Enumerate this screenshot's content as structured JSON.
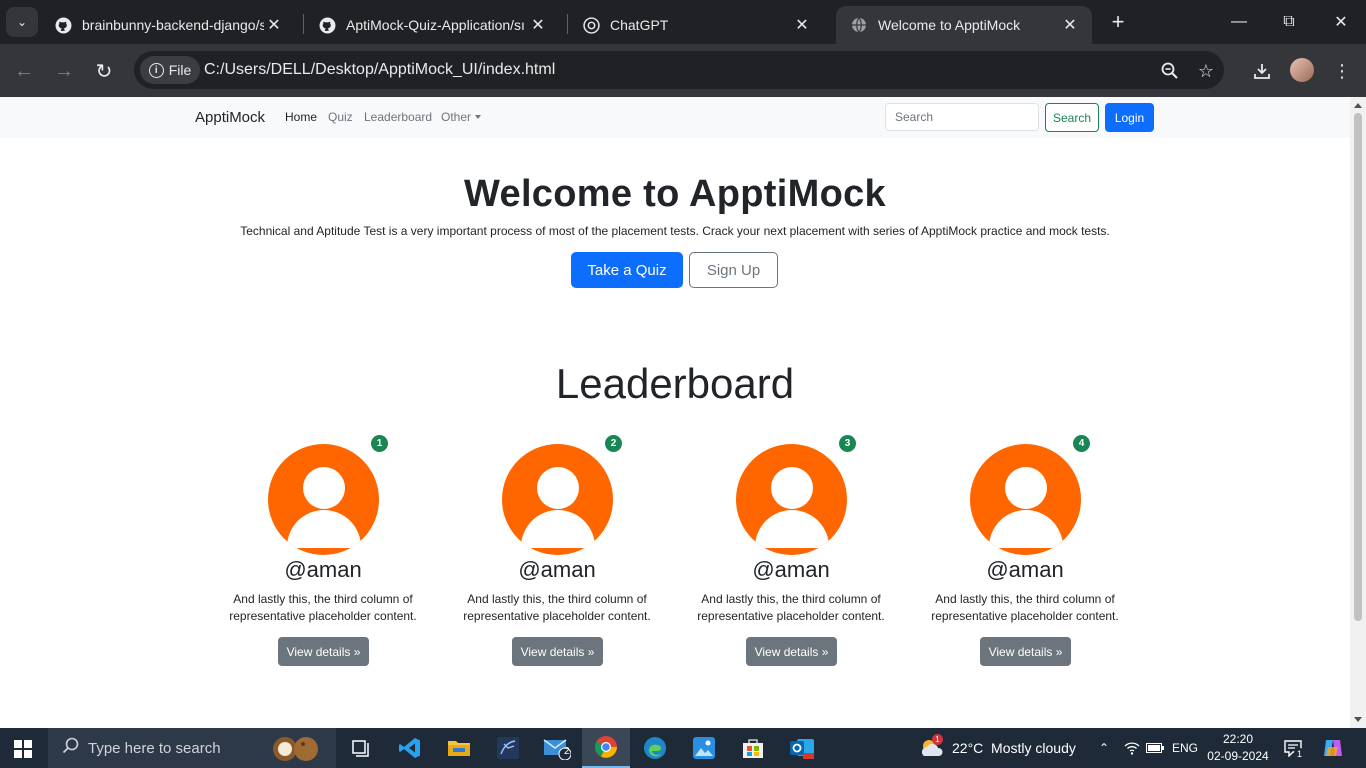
{
  "browser": {
    "tabs": [
      {
        "title": "brainbunny-backend-django/st",
        "icon": "github-icon"
      },
      {
        "title": "AptiMock-Quiz-Application/sı",
        "icon": "github-icon"
      },
      {
        "title": "ChatGPT",
        "icon": "chatgpt-icon"
      },
      {
        "title": "Welcome to ApptiMock",
        "icon": "globe-icon",
        "active": true
      }
    ],
    "address_chip": "File",
    "url": "C:/Users/DELL/Desktop/ApptiMock_UI/index.html"
  },
  "navbar": {
    "brand": "ApptiMock",
    "links": [
      "Home",
      "Quiz",
      "Leaderboard",
      "Other"
    ],
    "search_placeholder": "Search",
    "search_button": "Search",
    "login_button": "Login"
  },
  "hero": {
    "title": "Welcome to ApptiMock",
    "lead": "Technical and Aptitude Test is a very important process of most of the placement tests. Crack your next placement with series of ApptiMock practice and mock tests.",
    "primary_button": "Take a Quiz",
    "secondary_button": "Sign Up"
  },
  "leaderboard": {
    "title": "Leaderboard",
    "entries": [
      {
        "rank": "1",
        "username": "@aman",
        "description": "And lastly this, the third column of representative placeholder content.",
        "button": "View details »"
      },
      {
        "rank": "2",
        "username": "@aman",
        "description": "And lastly this, the third column of representative placeholder content.",
        "button": "View details »"
      },
      {
        "rank": "3",
        "username": "@aman",
        "description": "And lastly this, the third column of representative placeholder content.",
        "button": "View details »"
      },
      {
        "rank": "4",
        "username": "@aman",
        "description": "And lastly this, the third column of representative placeholder content.",
        "button": "View details »"
      }
    ]
  },
  "taskbar": {
    "search_placeholder": "Type here to search",
    "mail_badge": "2",
    "weather_badge": "1",
    "weather": "22°C  Mostly cloudy",
    "language": "ENG",
    "time": "22:20",
    "date": "02-09-2024",
    "notification_badge": "1"
  },
  "colors": {
    "primary": "#0d6efd",
    "success": "#198754",
    "secondary": "#6c757d",
    "avatar": "#ff6600"
  }
}
